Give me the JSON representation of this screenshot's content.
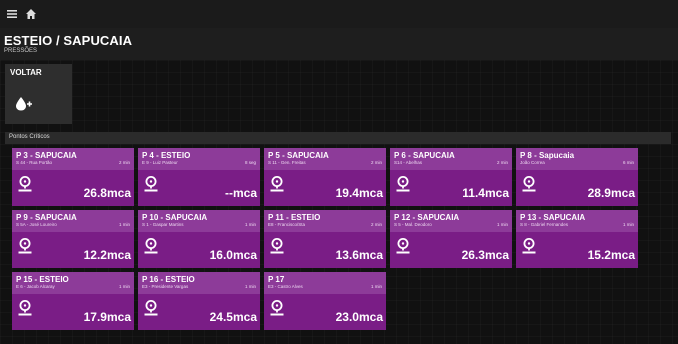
{
  "topbar": {
    "menu_icon": "menu-icon",
    "home_icon": "home-icon"
  },
  "header": {
    "title": "ESTEIO / SAPUCAIA",
    "subtitle": "PRESSÕES"
  },
  "back": {
    "label": "VOLTAR",
    "icon": "water-drop-icon"
  },
  "section": {
    "label": "Pontos Críticos"
  },
  "colors": {
    "tile_body": "#7a1d86",
    "tile_header": "#8d3b99",
    "background": "#111111"
  },
  "points": [
    {
      "name": "P 3 - SAPUCAIA",
      "address": "S 44 - Rua Portão",
      "time": "2 min",
      "value": "26.8mca"
    },
    {
      "name": "P 4 - ESTEIO",
      "address": "E 9 - Luiz Pasteur",
      "time": "8 seg",
      "value": "--mca"
    },
    {
      "name": "P 5 - SAPUCAIA",
      "address": "S 11 - Gen. Freitas",
      "time": "2 min",
      "value": "19.4mca"
    },
    {
      "name": "P 6 - SAPUCAIA",
      "address": "S14 - Abelhas",
      "time": "2 min",
      "value": "11.4mca"
    },
    {
      "name": "P 8 - Sapucaia",
      "address": "João Correa",
      "time": "6 min",
      "value": "28.9mca"
    },
    {
      "name": "P 9 - SAPUCAIA",
      "address": "S 5A - José Loureiro",
      "time": "1 min",
      "value": "12.2mca"
    },
    {
      "name": "P 10 - SAPUCAIA",
      "address": "S 1 - Gaspar Martins",
      "time": "1 min",
      "value": "16.0mca"
    },
    {
      "name": "P 11 - ESTEIO",
      "address": "E8 - Francisco/Sta",
      "time": "2 min",
      "value": "13.6mca"
    },
    {
      "name": "P 12 - SAPUCAIA",
      "address": "S 5 - Mal. Deodoro",
      "time": "1 min",
      "value": "26.3mca"
    },
    {
      "name": "P 13 - SAPUCAIA",
      "address": "S 8 - Gabriel Fernandes",
      "time": "1 min",
      "value": "15.2mca"
    },
    {
      "name": "P 15 - ESTEIO",
      "address": "E 6 - Jacob Alcaray",
      "time": "1 min",
      "value": "17.9mca"
    },
    {
      "name": "P 16 - ESTEIO",
      "address": "E3 - Presidente Vargas",
      "time": "1 min",
      "value": "24.5mca"
    },
    {
      "name": "P 17",
      "address": "E3 - Castro Alves",
      "time": "1 min",
      "value": "23.0mca"
    }
  ]
}
